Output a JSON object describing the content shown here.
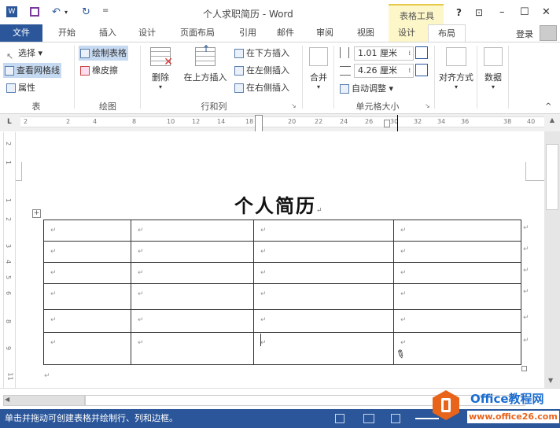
{
  "window": {
    "title": "个人求职简历 - Word",
    "context_tab_group": "表格工具",
    "help": "?",
    "restore_ribbon": "⊡",
    "minimize": "–",
    "maximize": "☐",
    "close": "✕",
    "quick_access": {
      "save": "save-icon",
      "undo": "↶",
      "redo": "↻",
      "customize": "="
    }
  },
  "tabs": [
    {
      "label": "文件"
    },
    {
      "label": "开始"
    },
    {
      "label": "插入"
    },
    {
      "label": "设计"
    },
    {
      "label": "页面布局"
    },
    {
      "label": "引用"
    },
    {
      "label": "邮件"
    },
    {
      "label": "审阅"
    },
    {
      "label": "视图"
    },
    {
      "label": "设计"
    },
    {
      "label": "布局"
    }
  ],
  "signin": "登录",
  "ribbon": {
    "table_group": {
      "label": "表",
      "select": "选择 ▾",
      "view_gridlines": "查看网格线",
      "properties": "属性"
    },
    "draw_group": {
      "label": "绘图",
      "draw_table": "绘制表格",
      "eraser": "橡皮擦"
    },
    "rows_cols_group": {
      "label": "行和列",
      "delete": "删除",
      "delete_arrow": "▾",
      "insert_above": "在上方插入",
      "insert_below": "在下方插入",
      "insert_left": "在左侧插入",
      "insert_right": "在右侧插入",
      "launcher": "↘"
    },
    "merge_group": {
      "label": "合并",
      "arrow": "▾"
    },
    "cell_size_group": {
      "label": "单元格大小",
      "height": "1.01 厘米",
      "width": "4.26 厘米",
      "autofit": "自动调整 ▾",
      "launcher": "↘"
    },
    "alignment": {
      "label": "对齐方式",
      "arrow": "▾"
    },
    "data": {
      "label": "数据",
      "arrow": "▾"
    },
    "collapse": "^"
  },
  "ruler": {
    "corner": "L",
    "ticks": [
      "2",
      "2",
      "4",
      "8",
      "10",
      "12",
      "14",
      "18",
      "20",
      "22",
      "24",
      "26",
      "30",
      "32",
      "34",
      "36",
      "38",
      "40"
    ],
    "vticks": [
      "2",
      "1",
      "1",
      "2",
      "3",
      "4",
      "5",
      "6",
      "8",
      "9",
      "11"
    ]
  },
  "document": {
    "heading": "个人简历",
    "para_mark": "↵",
    "table": {
      "rows": 6,
      "cols": 4,
      "cells": [
        [
          "↵",
          "↵",
          "↵",
          "↵"
        ],
        [
          "↵",
          "↵",
          "↵",
          "↵"
        ],
        [
          "↵",
          "↵",
          "↵",
          "↵"
        ],
        [
          "↵",
          "↵",
          "↵",
          "↵"
        ],
        [
          "↵",
          "↵",
          "↵",
          "↵"
        ],
        [
          "↵",
          "↵",
          "↵",
          "↵"
        ]
      ]
    }
  },
  "status": {
    "message": "单击并拖动可创建表格并绘制行、列和边框。",
    "watermark_title": "Office教程网",
    "watermark_url": "www.office26.com"
  },
  "colors": {
    "brand": "#2b579a",
    "context_tab": "#fdf6c9",
    "selected": "#c5d9f1"
  }
}
